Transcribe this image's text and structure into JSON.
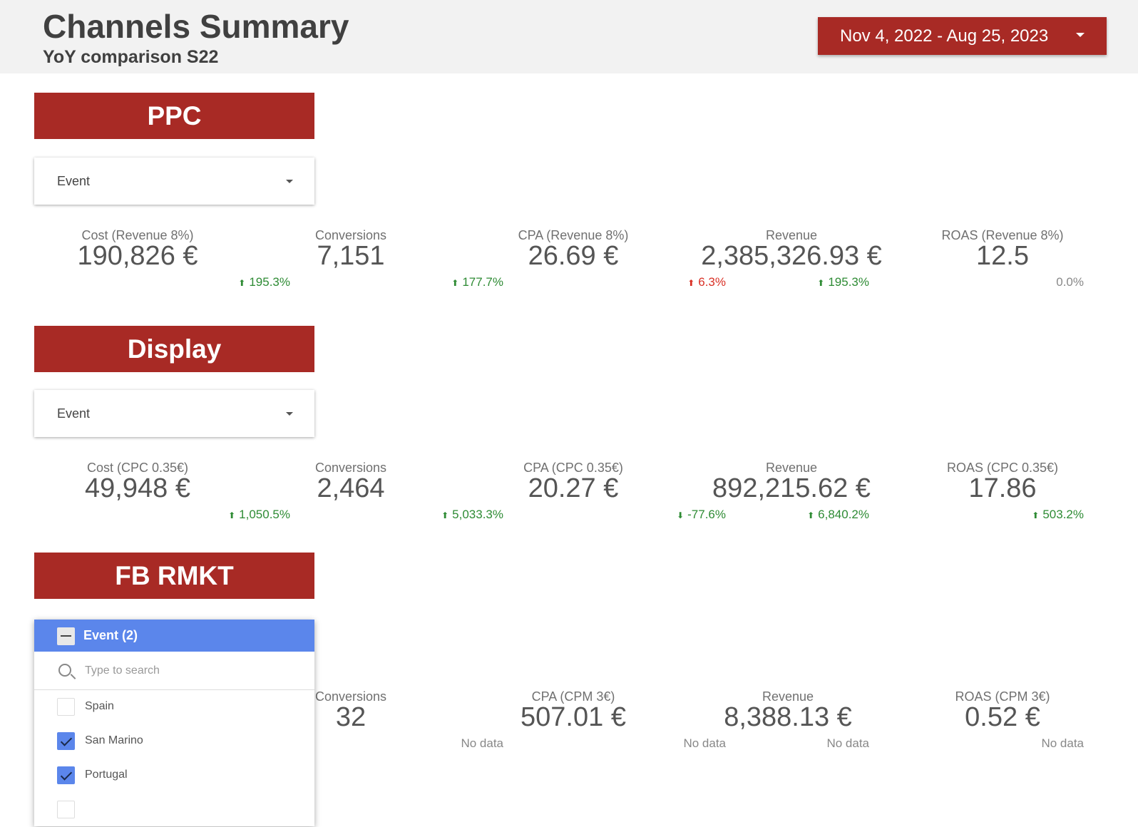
{
  "header": {
    "title": "Channels Summary",
    "subtitle": "YoY comparison S22",
    "date_range": "Nov 4, 2022 - Aug 25, 2023"
  },
  "colors": {
    "brand_red": "#a82a25",
    "positive": "#2e8b34",
    "negative": "#d93025",
    "selection_blue": "#5b86eb"
  },
  "sections": [
    {
      "name": "PPC",
      "event_label": "Event",
      "kpis": [
        {
          "label": "Cost (Revenue 8%)",
          "value": "190,826 €",
          "delta": "195.3%",
          "trend": "up"
        },
        {
          "label": "Conversions",
          "value": "7,151",
          "delta": "177.7%",
          "trend": "up"
        },
        {
          "label": "CPA (Revenue 8%)",
          "value": "26.69 €",
          "delta": "6.3%",
          "trend": "up-bad"
        },
        {
          "label": "Revenue",
          "value": "2,385,326.93 €",
          "delta": "195.3%",
          "trend": "up"
        },
        {
          "label": "ROAS (Revenue 8%)",
          "value": "12.5",
          "delta": "0.0%",
          "trend": "neutral"
        }
      ]
    },
    {
      "name": "Display",
      "event_label": "Event",
      "kpis": [
        {
          "label": "Cost (CPC 0.35€)",
          "value": "49,948 €",
          "delta": "1,050.5%",
          "trend": "up"
        },
        {
          "label": "Conversions",
          "value": "2,464",
          "delta": "5,033.3%",
          "trend": "up"
        },
        {
          "label": "CPA (CPC 0.35€)",
          "value": "20.27 €",
          "delta": "-77.6%",
          "trend": "down-good"
        },
        {
          "label": "Revenue",
          "value": "892,215.62 €",
          "delta": "6,840.2%",
          "trend": "up"
        },
        {
          "label": "ROAS (CPC 0.35€)",
          "value": "17.86",
          "delta": "503.2%",
          "trend": "up"
        }
      ]
    },
    {
      "name": "FB RMKT",
      "kpis": [
        {
          "label": "Conversions",
          "value": "32",
          "delta": "No data"
        },
        {
          "label": "CPA (CPM 3€)",
          "value": "507.01 €",
          "delta": "No data"
        },
        {
          "label": "Revenue",
          "value": "8,388.13 €",
          "delta": "No data"
        },
        {
          "label": "ROAS (CPM 3€)",
          "value": "0.52 €",
          "delta": "No data"
        }
      ]
    }
  ],
  "dropdown": {
    "title": "Event (2)",
    "search_placeholder": "Type to search",
    "options": [
      {
        "label": "Spain",
        "checked": false
      },
      {
        "label": "San Marino",
        "checked": true
      },
      {
        "label": "Portugal",
        "checked": true
      }
    ]
  }
}
